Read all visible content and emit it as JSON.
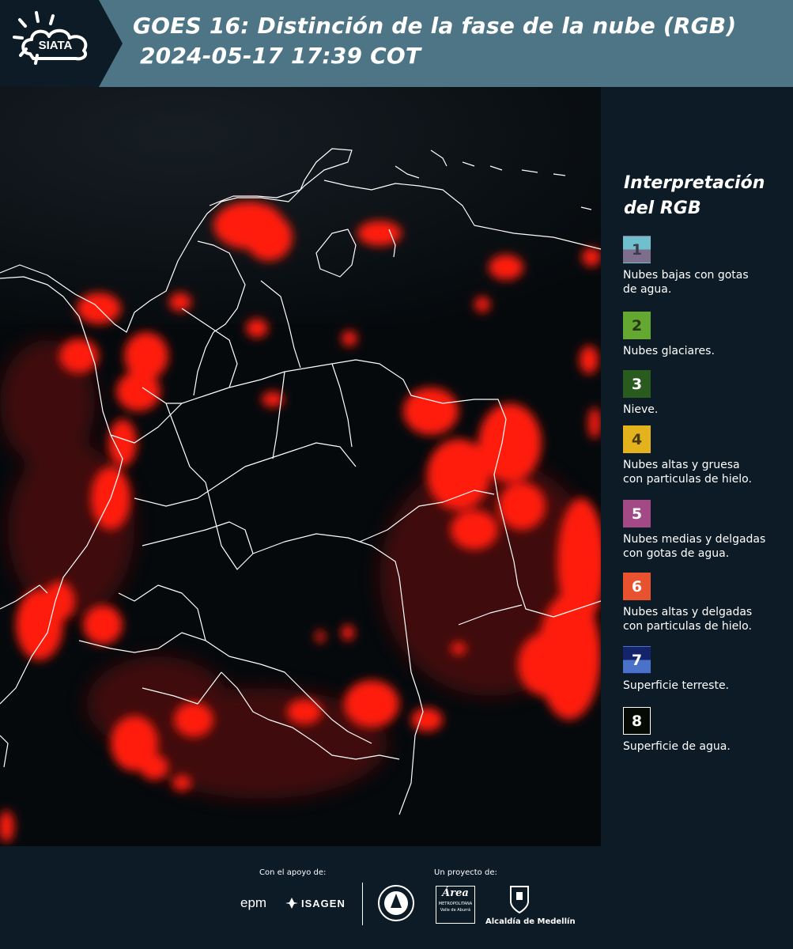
{
  "header": {
    "logo_text": "SIATA",
    "title_line1": "GOES 16: Distinción de la fase de la nube (RGB)",
    "title_line2": "2024-05-17 17:39 COT"
  },
  "map": {
    "icon": "satellite-map",
    "cloud_color": "#ff1a10",
    "background_color": "#05090c"
  },
  "legend": {
    "title_line1": "Interpretación",
    "title_line2": "del RGB",
    "items": [
      {
        "number": "1",
        "text_line1": "Nubes bajas con gotas",
        "text_line2": "de agua.",
        "color_top": "#6fbfcc",
        "color_bottom": "#7c6e8c",
        "number_color": "#3a3a4a"
      },
      {
        "number": "2",
        "text_line1": "Nubes glaciares.",
        "text_line2": "",
        "color_top": "#64a832",
        "color_bottom": "#64a832",
        "number_color": "#243a14"
      },
      {
        "number": "3",
        "text_line1": "Nieve.",
        "text_line2": "",
        "color_top": "#2a5b1e",
        "color_bottom": "#2a5b1e",
        "number_color": "#ffffff"
      },
      {
        "number": "4",
        "text_line1": "Nubes altas y gruesa",
        "text_line2": "con particulas de hielo.",
        "color_top": "#e3b21c",
        "color_bottom": "#e3b21c",
        "number_color": "#4a3a10"
      },
      {
        "number": "5",
        "text_line1": "Nubes medias y delgadas",
        "text_line2": "con gotas de agua.",
        "color_top": "#a34a86",
        "color_bottom": "#a34a86",
        "number_color": "#ffffff"
      },
      {
        "number": "6",
        "text_line1": "Nubes altas y delgadas",
        "text_line2": "con particulas de hielo.",
        "color_top": "#e8522e",
        "color_bottom": "#e8522e",
        "number_color": "#ffffff"
      },
      {
        "number": "7",
        "text_line1": "Superficie terreste.",
        "text_line2": "",
        "color_top": "#15246a",
        "color_bottom": "#4a72c8",
        "number_color": "#ffffff"
      },
      {
        "number": "8",
        "text_line1": "Superficie de agua.",
        "text_line2": "",
        "color_top": "#050a05",
        "color_bottom": "#050a05",
        "number_color": "#ffffff"
      }
    ]
  },
  "footer": {
    "support_label": "Con el apoyo de:",
    "project_label": "Un proyecto de:",
    "epm": "epm",
    "isagen": "ISAGEN",
    "area_line1": "Área",
    "area_line2": "METROPOLITANA",
    "area_line3": "Valle de Aburrá",
    "alcaldia": "Alcaldía de Medellín"
  }
}
